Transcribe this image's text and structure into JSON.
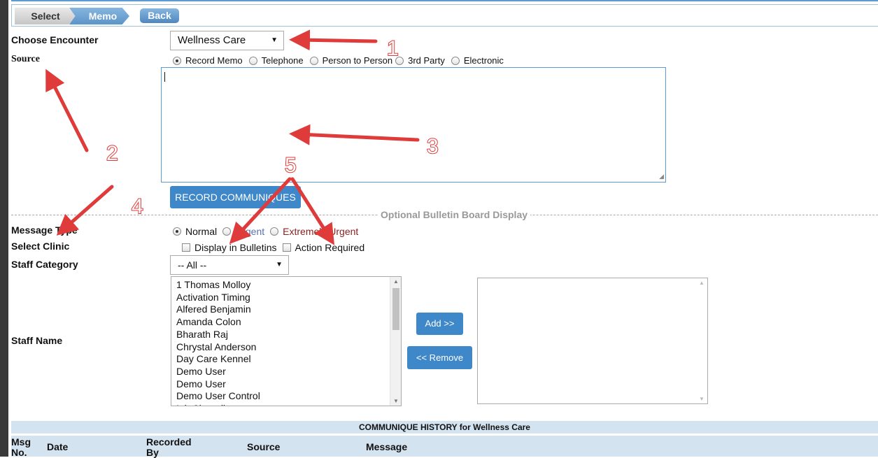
{
  "breadcrumb": {
    "step1": "Select",
    "step2": "Memo",
    "back": "Back"
  },
  "form": {
    "encounter_label": "Choose Encounter",
    "encounter_value": "Wellness Care",
    "source_label": "Source",
    "source_options": [
      "Record Memo",
      "Telephone",
      "Person to Person",
      "3rd Party",
      "Electronic"
    ],
    "source_selected": "Record Memo",
    "memo_text": "",
    "record_button": "RECORD COMMUNIQUES",
    "bulletin_divider": "Optional Bulletin Board Display",
    "message_type_label": "Message Type",
    "message_types": [
      "Normal",
      "Urgent",
      "Extremely Urgent"
    ],
    "message_type_selected": "Normal",
    "select_clinic_label": "Select Clinic",
    "display_in_bulletins": "Display in Bulletins",
    "action_required": "Action Required",
    "staff_category_label": "Staff Category",
    "staff_category_value": "-- All --",
    "staff_name_label": "Staff Name",
    "staff_names": [
      "1 Thomas Molloy",
      "Activation Timing",
      "Alfered Benjamin",
      "Amanda Colon",
      "Bharath Raj",
      "Chrystal Anderson",
      "Day Care Kennel",
      "Demo User",
      "Demo User",
      "Demo User Control",
      "Ink Chanell"
    ],
    "add_button": "Add >>",
    "remove_button": "<< Remove"
  },
  "history": {
    "title": "COMMUNIQUE HISTORY for Wellness Care",
    "columns": [
      "Msg No.",
      "Date",
      "Recorded By",
      "Source",
      "Message"
    ]
  },
  "annotations": [
    "1",
    "2",
    "3",
    "4",
    "5"
  ],
  "colors": {
    "accent": "#3e87c9",
    "annotation": "#e03b3b",
    "urgent": "#5b6fb0",
    "extremely_urgent": "#8a1f1f",
    "header_bg": "#d4e3f0"
  }
}
